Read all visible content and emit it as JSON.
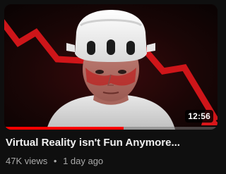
{
  "video": {
    "title": "Virtual Reality isn't Fun Anymore...",
    "views": "47K views",
    "separator": "•",
    "age": "1 day ago",
    "duration": "12:56",
    "watch_progress_fraction": 0.56,
    "thumbnail_icon": "thumbnail-image"
  },
  "colors": {
    "background": "#0f0f0f",
    "title_text": "#f1f1f1",
    "meta_text": "#aaaaaa",
    "progress_fill": "#ff0000",
    "thumbnail_arrow": "#d8161a"
  }
}
